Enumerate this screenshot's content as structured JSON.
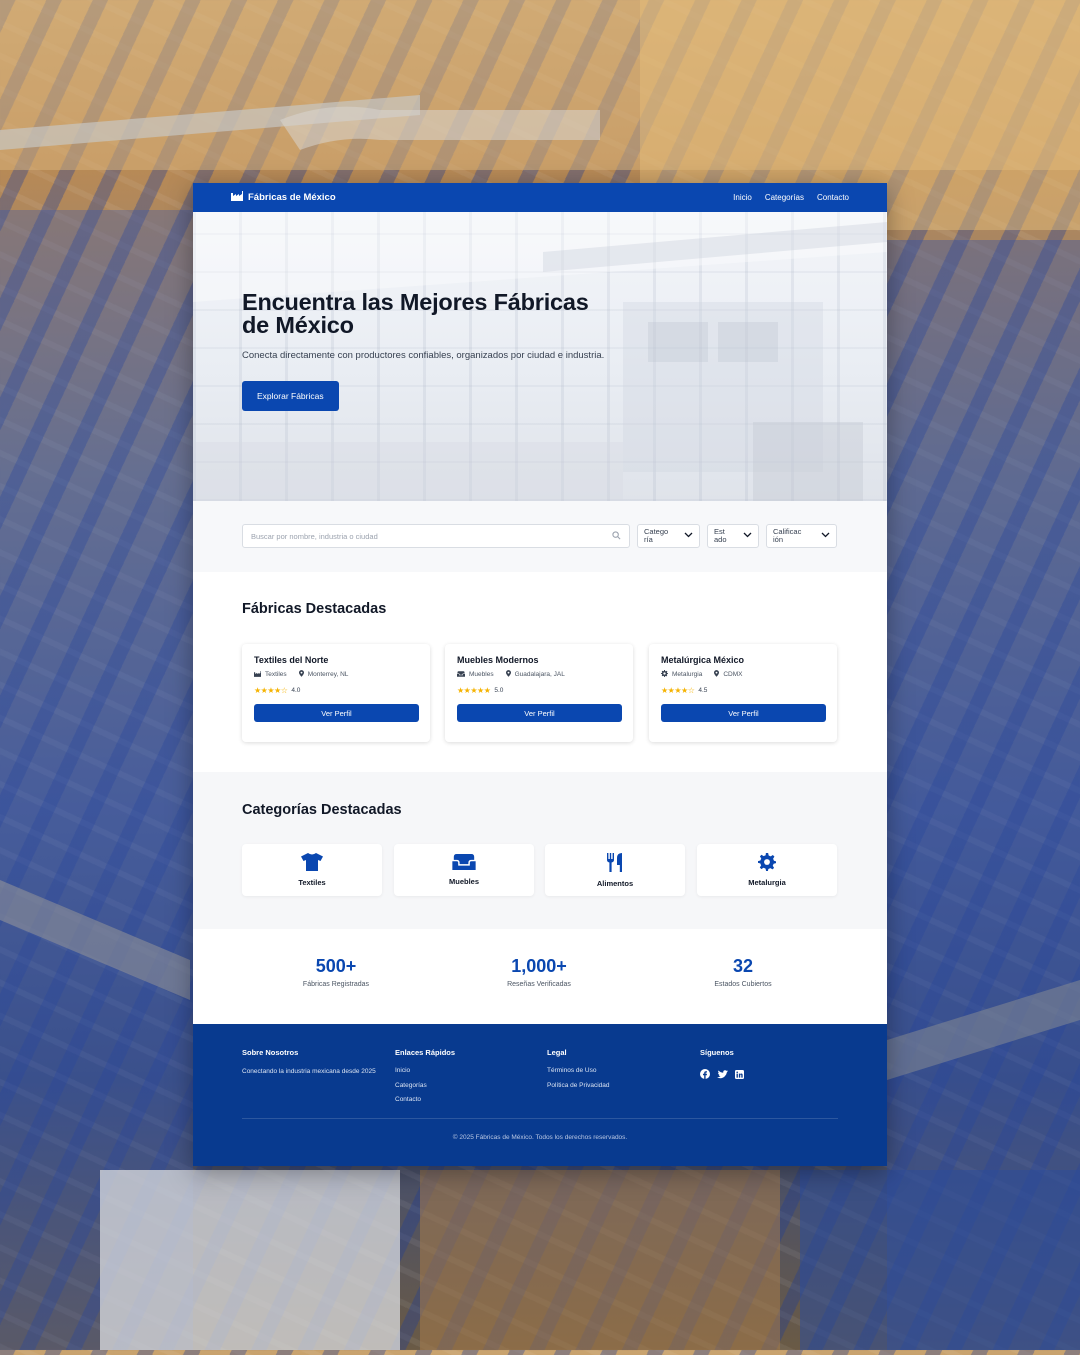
{
  "nav": {
    "brand": "Fábricas de México",
    "links": [
      "Inicio",
      "Categorías",
      "Contacto"
    ]
  },
  "hero": {
    "title_line1": "Encuentra las Mejores Fábricas",
    "title_line2": "de México",
    "subtitle": "Conecta directamente con productores confiables, organizados por ciudad e industria.",
    "cta": "Explorar Fábricas"
  },
  "search": {
    "placeholder": "Buscar por nombre, industria o ciudad",
    "filters": [
      {
        "line1": "Catego",
        "line2": "ría"
      },
      {
        "line1": "Est",
        "line2": "ado"
      },
      {
        "line1": "Calificac",
        "line2": "ión"
      }
    ]
  },
  "featured": {
    "title": "Fábricas Destacadas",
    "button_label": "Ver Perfil",
    "factories": [
      {
        "name": "Textiles del Norte",
        "category": "Textiles",
        "category_icon": "factory-icon",
        "city": "Monterrey, NL",
        "rating": "4.0",
        "stars": "★★★★☆"
      },
      {
        "name": "Muebles Modernos",
        "category": "Muebles",
        "category_icon": "couch-icon",
        "city": "Guadalajara, JAL",
        "rating": "5.0",
        "stars": "★★★★★"
      },
      {
        "name": "Metalúrgica México",
        "category": "Metalurgia",
        "category_icon": "gear-icon",
        "city": "CDMX",
        "rating": "4.5",
        "stars": "★★★★☆"
      }
    ]
  },
  "categories": {
    "title": "Categorías Destacadas",
    "items": [
      {
        "label": "Textiles",
        "icon": "shirt-icon"
      },
      {
        "label": "Muebles",
        "icon": "couch-icon"
      },
      {
        "label": "Alimentos",
        "icon": "utensils-icon"
      },
      {
        "label": "Metalurgia",
        "icon": "gear-icon"
      }
    ]
  },
  "stats": [
    {
      "value": "500+",
      "label": "Fábricas Registradas"
    },
    {
      "value": "1,000+",
      "label": "Reseñas Verificadas"
    },
    {
      "value": "32",
      "label": "Estados Cubiertos"
    }
  ],
  "footer": {
    "about_title": "Sobre Nosotros",
    "about_text": "Conectando la industria mexicana desde 2025",
    "links_title": "Enlaces Rápidos",
    "links": [
      "Inicio",
      "Categorías",
      "Contacto"
    ],
    "legal_title": "Legal",
    "legal_links": [
      "Términos de Uso",
      "Política de Privacidad"
    ],
    "social_title": "Síguenos",
    "social_icons": [
      "facebook-icon",
      "twitter-icon",
      "linkedin-icon"
    ],
    "copyright": "© 2025 Fábricas de México. Todos los derechos reservados."
  },
  "colors": {
    "primary": "#0a47b0",
    "footer": "#083a8f",
    "star": "#f5b301"
  }
}
